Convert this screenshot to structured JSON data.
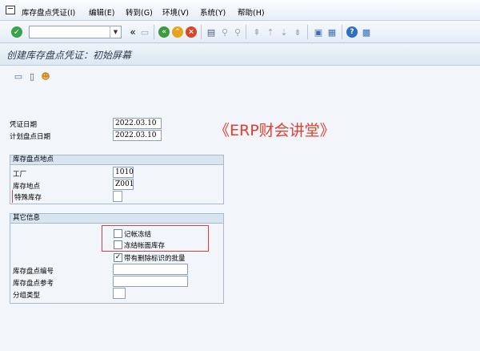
{
  "menu": {
    "items": [
      {
        "label": "库存盘点凭证(I)"
      },
      {
        "label": "编辑(E)"
      },
      {
        "label": "转到(G)"
      },
      {
        "label": "环境(V)"
      },
      {
        "label": "系统(Y)"
      },
      {
        "label": "帮助(H)"
      }
    ]
  },
  "toolbar": {
    "command_field_value": "",
    "history_glyph": "«"
  },
  "title": "创建库存盘点凭证：初始屏幕",
  "form": {
    "doc_date_label": "凭证日期",
    "doc_date_value": "2022.03.10",
    "planned_date_label": "计划盘点日期",
    "planned_date_value": "2022.03.10",
    "location_group": {
      "title": "库存盘点地点",
      "plant_label": "工厂",
      "plant_value": "1010",
      "storage_label": "库存地点",
      "storage_value": "Z001",
      "special_stock_label": "特殊库存"
    },
    "other_group": {
      "title": "其它信息",
      "posting_block_label": "记帐冻结",
      "posting_block_checked": false,
      "freeze_book_label": "冻结帐面库存",
      "freeze_book_checked": false,
      "deletion_batches_label": "带有删除标识的批量",
      "deletion_batches_checked": true,
      "phys_inv_no_label": "库存盘点编号",
      "phys_inv_ref_label": "库存盘点参考",
      "grouping_label": "分组类型"
    }
  },
  "watermark": "《ERP财会讲堂》"
}
